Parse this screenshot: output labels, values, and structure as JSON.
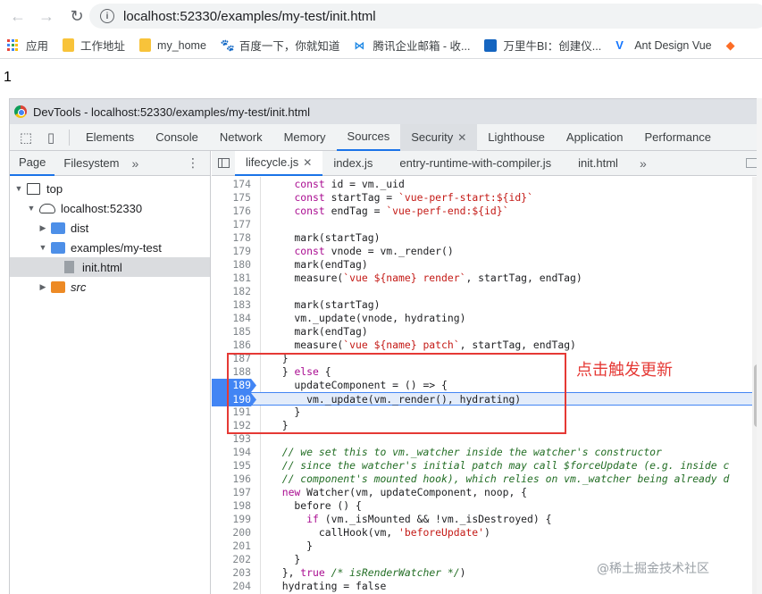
{
  "browser": {
    "url": "localhost:52330/examples/my-test/init.html",
    "bookmarks": [
      {
        "label": "应用",
        "icon": "apps-grid-icon"
      },
      {
        "label": "工作地址",
        "icon": "folder-icon"
      },
      {
        "label": "my_home",
        "icon": "folder-icon"
      },
      {
        "label": "百度一下，你就知道",
        "icon": "baidu-paw-icon"
      },
      {
        "label": "腾讯企业邮箱 - 收...",
        "icon": "tencent-mail-icon"
      },
      {
        "label": "万里牛BI：创建仪...",
        "icon": "wanliniu-icon"
      },
      {
        "label": "Ant Design Vue",
        "icon": "ant-design-icon"
      }
    ]
  },
  "page": {
    "text": "1"
  },
  "devtools": {
    "title": "DevTools - localhost:52330/examples/my-test/init.html",
    "tabs": [
      "Elements",
      "Console",
      "Network",
      "Memory",
      "Sources",
      "Security",
      "Lighthouse",
      "Application",
      "Performance"
    ],
    "active_tab": "Sources",
    "navigator": {
      "tabs": [
        "Page",
        "Filesystem"
      ],
      "more": "»",
      "tree": [
        {
          "label": "top",
          "indent": 0,
          "arrow": "▼",
          "icon": "frame"
        },
        {
          "label": "localhost:52330",
          "indent": 1,
          "arrow": "▼",
          "icon": "cloud"
        },
        {
          "label": "dist",
          "indent": 2,
          "arrow": "▶",
          "icon": "folder-blue"
        },
        {
          "label": "examples/my-test",
          "indent": 2,
          "arrow": "▼",
          "icon": "folder-blue"
        },
        {
          "label": "init.html",
          "indent": 3,
          "arrow": "",
          "icon": "file"
        },
        {
          "label": "src",
          "indent": 2,
          "arrow": "▶",
          "icon": "folder-orange"
        }
      ]
    },
    "file_tabs": [
      "lifecycle.js",
      "index.js",
      "entry-runtime-with-compiler.js",
      "init.html"
    ],
    "file_tabs_more": "»",
    "code_lines": [
      {
        "n": "174",
        "code": "    const id = vm._uid"
      },
      {
        "n": "175",
        "code": "    const startTag = `vue-perf-start:${id}`"
      },
      {
        "n": "176",
        "code": "    const endTag = `vue-perf-end:${id}`"
      },
      {
        "n": "177",
        "code": ""
      },
      {
        "n": "178",
        "code": "    mark(startTag)"
      },
      {
        "n": "179",
        "code": "    const vnode = vm._render()"
      },
      {
        "n": "180",
        "code": "    mark(endTag)"
      },
      {
        "n": "181",
        "code": "    measure(`vue ${name} render`, startTag, endTag)"
      },
      {
        "n": "182",
        "code": ""
      },
      {
        "n": "183",
        "code": "    mark(startTag)"
      },
      {
        "n": "184",
        "code": "    vm._update(vnode, hydrating)"
      },
      {
        "n": "185",
        "code": "    mark(endTag)"
      },
      {
        "n": "186",
        "code": "    measure(`vue ${name} patch`, startTag, endTag)"
      },
      {
        "n": "187",
        "code": "  }"
      },
      {
        "n": "188",
        "code": "  } else {"
      },
      {
        "n": "189",
        "code": "    updateComponent = () => {"
      },
      {
        "n": "190",
        "code": "      vm._update(vm._render(), hydrating)"
      },
      {
        "n": "191",
        "code": "    }"
      },
      {
        "n": "192",
        "code": "  }"
      },
      {
        "n": "193",
        "code": ""
      },
      {
        "n": "194",
        "code": "  // we set this to vm._watcher inside the watcher's constructor"
      },
      {
        "n": "195",
        "code": "  // since the watcher's initial patch may call $forceUpdate (e.g. inside c"
      },
      {
        "n": "196",
        "code": "  // component's mounted hook), which relies on vm._watcher being already d"
      },
      {
        "n": "197",
        "code": "  new Watcher(vm, updateComponent, noop, {"
      },
      {
        "n": "198",
        "code": "    before () {"
      },
      {
        "n": "199",
        "code": "      if (vm._isMounted && !vm._isDestroyed) {"
      },
      {
        "n": "200",
        "code": "        callHook(vm, 'beforeUpdate')"
      },
      {
        "n": "201",
        "code": "      }"
      },
      {
        "n": "202",
        "code": "    }"
      },
      {
        "n": "203",
        "code": "  }, true /* isRenderWatcher */)"
      },
      {
        "n": "204",
        "code": "  hydrating = false"
      }
    ],
    "breakpoint_lines": [
      "189",
      "190"
    ],
    "exec_line": "190"
  },
  "annotation": {
    "text": "点击触发更新",
    "color": "#e53935"
  },
  "watermark": "@稀土掘金技术社区"
}
